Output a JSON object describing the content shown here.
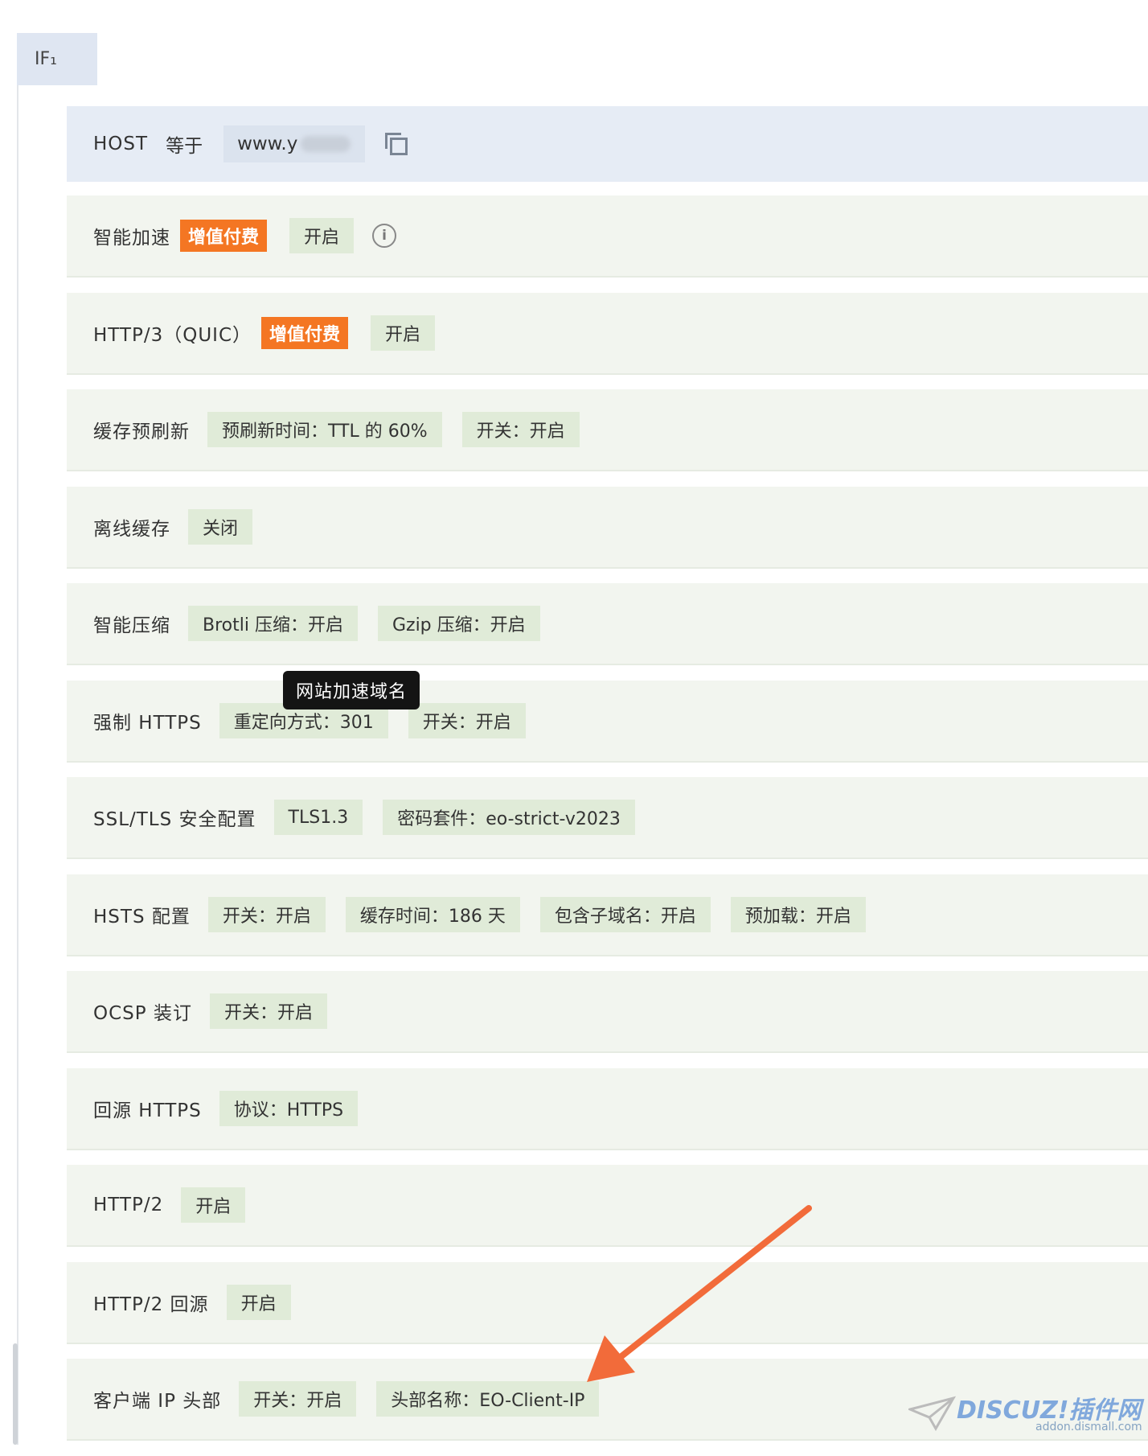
{
  "if_label": "IF₁",
  "host_row": {
    "label": "HOST",
    "operator": "等于",
    "value": "www.y"
  },
  "paid_badge": "增值付费",
  "rows": [
    {
      "label": "智能加速",
      "paid": true,
      "tags": [
        "开启"
      ],
      "info": true
    },
    {
      "label": "HTTP/3（QUIC）",
      "paid": true,
      "tags": [
        "开启"
      ]
    },
    {
      "label": "缓存预刷新",
      "tags": [
        "预刷新时间：TTL 的 60%",
        "开关：开启"
      ]
    },
    {
      "label": "离线缓存",
      "tags": [
        "关闭"
      ]
    },
    {
      "label": "智能压缩",
      "tags": [
        "Brotli 压缩：开启",
        "Gzip 压缩：开启"
      ]
    },
    {
      "label": "强制 HTTPS",
      "tags": [
        "重定向方式：301",
        "开关：开启"
      ]
    },
    {
      "label": "SSL/TLS 安全配置",
      "tags": [
        "TLS1.3",
        "密码套件：eo-strict-v2023"
      ]
    },
    {
      "label": "HSTS 配置",
      "tags": [
        "开关：开启",
        "缓存时间：186 天",
        "包含子域名：开启",
        "预加载：开启"
      ]
    },
    {
      "label": "OCSP 装订",
      "tags": [
        "开关：开启"
      ]
    },
    {
      "label": "回源 HTTPS",
      "tags": [
        "协议：HTTPS"
      ]
    },
    {
      "label": "HTTP/2",
      "tags": [
        "开启"
      ]
    },
    {
      "label": "HTTP/2 回源",
      "tags": [
        "开启"
      ]
    },
    {
      "label": "客户端 IP 头部",
      "tags": [
        "开关：开启",
        "头部名称：EO-Client-IP"
      ]
    }
  ],
  "tooltip": "网站加速域名",
  "watermark": {
    "main": "DISCUZ!插件网",
    "sub": "addon.dismall.com"
  },
  "colors": {
    "paid_badge": "#f47623",
    "arrow": "#f26b3a",
    "row_bg": "#f2f5ef",
    "tag_bg": "#e0ebd8",
    "host_bg": "#e6ecf5"
  },
  "icons": {
    "copy": "copy-icon",
    "info": "info-icon",
    "arrow": "arrow-annotation"
  }
}
